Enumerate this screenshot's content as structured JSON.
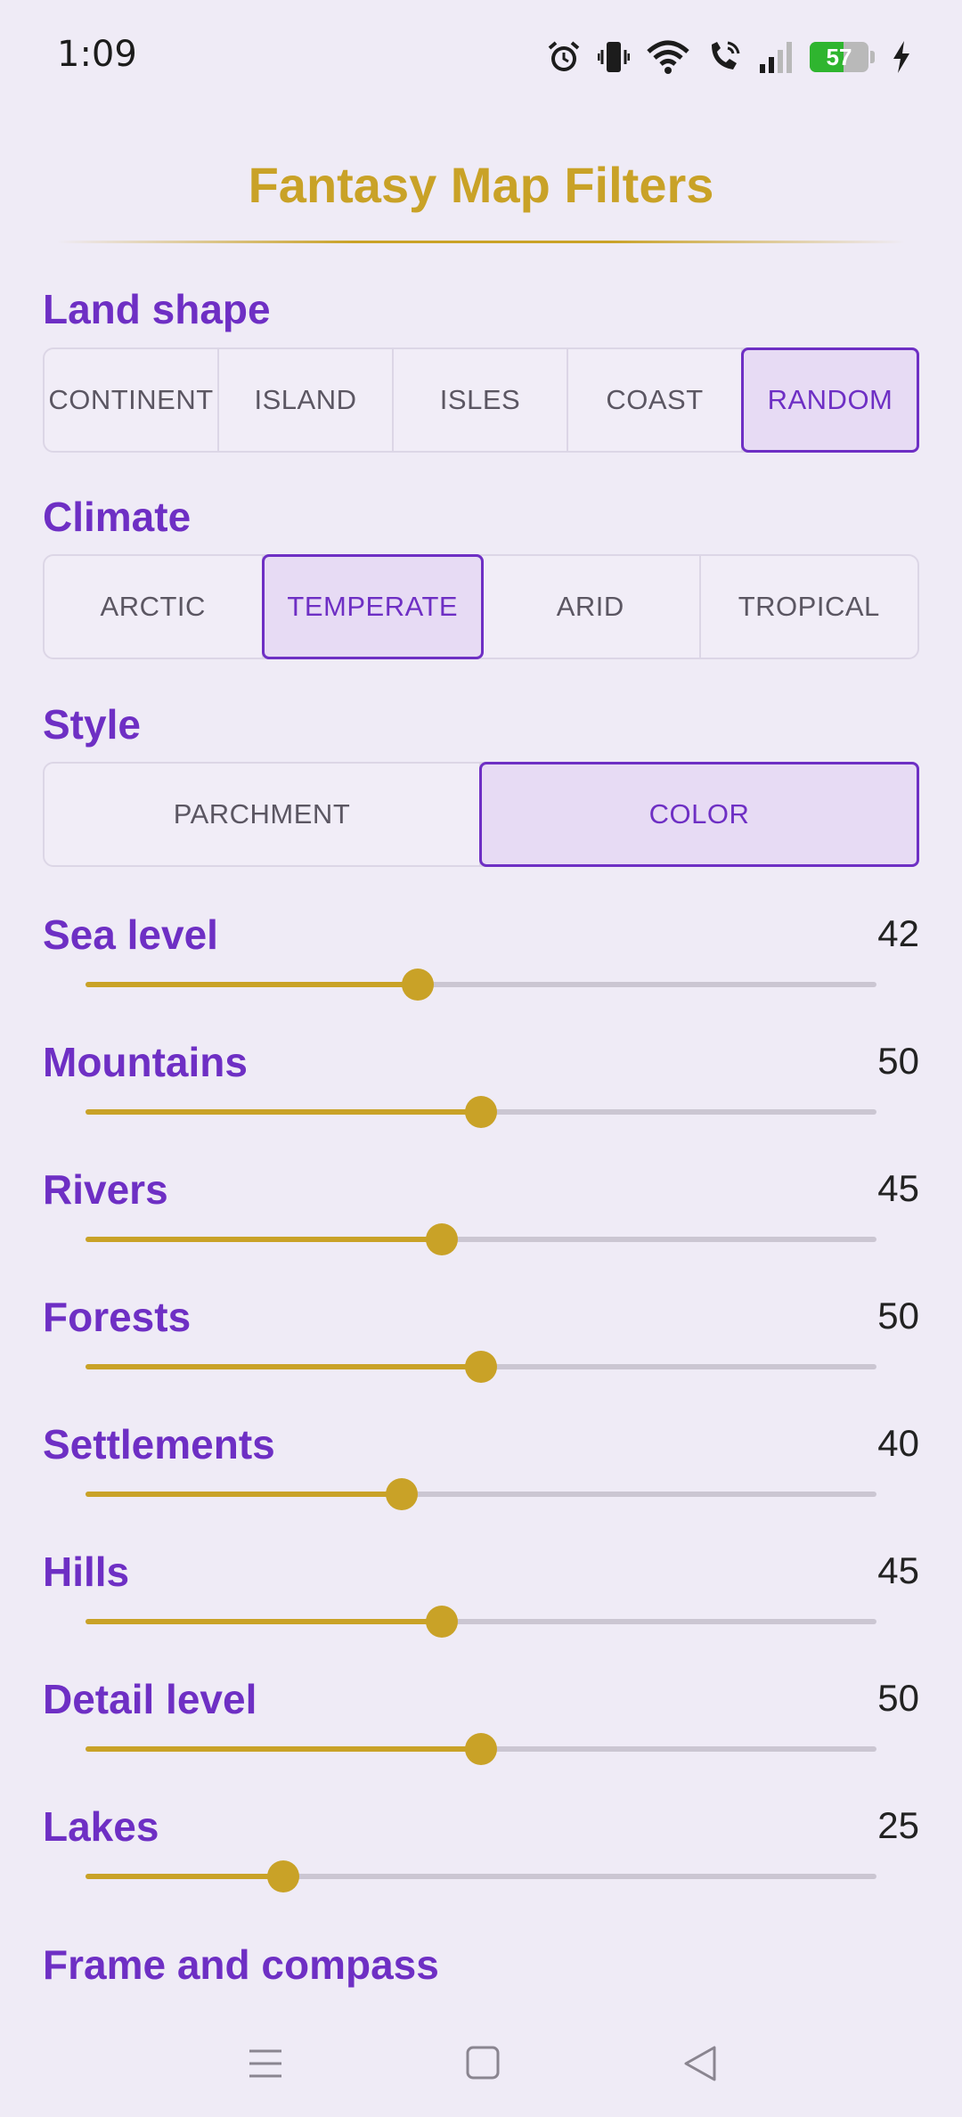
{
  "status": {
    "time": "1:09",
    "battery": "57",
    "battery_level": 0.57
  },
  "title": "Fantasy Map Filters",
  "land_shape": {
    "label": "Land shape",
    "options": [
      "CONTINENT",
      "ISLAND",
      "ISLES",
      "COAST",
      "RANDOM"
    ],
    "selected": "RANDOM"
  },
  "climate": {
    "label": "Climate",
    "options": [
      "ARCTIC",
      "TEMPERATE",
      "ARID",
      "TROPICAL"
    ],
    "selected": "TEMPERATE"
  },
  "style": {
    "label": "Style",
    "options": [
      "PARCHMENT",
      "COLOR"
    ],
    "selected": "COLOR"
  },
  "sliders": [
    {
      "label": "Sea level",
      "value": "42",
      "level": 0.42
    },
    {
      "label": "Mountains",
      "value": "50",
      "level": 0.5
    },
    {
      "label": "Rivers",
      "value": "45",
      "level": 0.45
    },
    {
      "label": "Forests",
      "value": "50",
      "level": 0.5
    },
    {
      "label": "Settlements",
      "value": "40",
      "level": 0.4
    },
    {
      "label": "Hills",
      "value": "45",
      "level": 0.45
    },
    {
      "label": "Detail level",
      "value": "50",
      "level": 0.5
    },
    {
      "label": "Lakes",
      "value": "25",
      "level": 0.25
    }
  ],
  "frame_section": {
    "label": "Frame and compass"
  },
  "colors": {
    "accent": "#6e2fc4",
    "gold": "#c9a227",
    "background": "#efebf6"
  },
  "icons": {
    "status": [
      "alarm-icon",
      "vibrate-icon",
      "wifi-icon",
      "wifi-call-icon",
      "signal-icon",
      "battery-icon",
      "charging-icon"
    ],
    "nav": [
      "menu-icon",
      "home-icon",
      "back-icon"
    ]
  }
}
